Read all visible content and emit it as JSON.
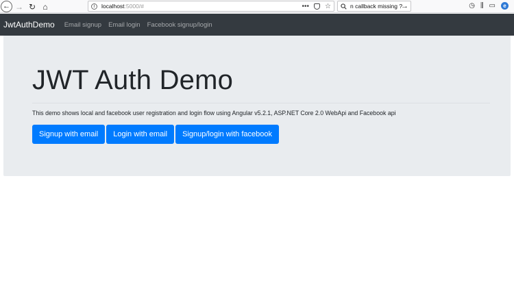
{
  "browser": {
    "url_host": "localhost",
    "url_rest": ":5000/#",
    "search_text": "n callback missing ?",
    "icons": [
      "back-arrow-icon",
      "forward-arrow-icon",
      "reload-icon",
      "home-icon",
      "page-info-icon",
      "more-actions-icon",
      "pocket-icon",
      "bookmark-star-icon",
      "search-go-arrow-icon",
      "history-icon",
      "library-icon",
      "sidebar-icon",
      "extension-icon"
    ]
  },
  "navbar": {
    "brand": "JwtAuthDemo",
    "links": [
      "Email signup",
      "Email login",
      "Facebook signup/login"
    ]
  },
  "jumbotron": {
    "title": "JWT Auth Demo",
    "lead": "This demo shows local and facebook user registration and login flow using Angular v5.2.1, ASP.NET Core 2.0 WebApi and Facebook api",
    "buttons": [
      "Signup with email",
      "Login with email",
      "Signup/login with facebook"
    ]
  },
  "colors": {
    "navbar_bg": "#343a40",
    "jumbotron_bg": "#e9ecef",
    "primary_button": "#007bff"
  }
}
